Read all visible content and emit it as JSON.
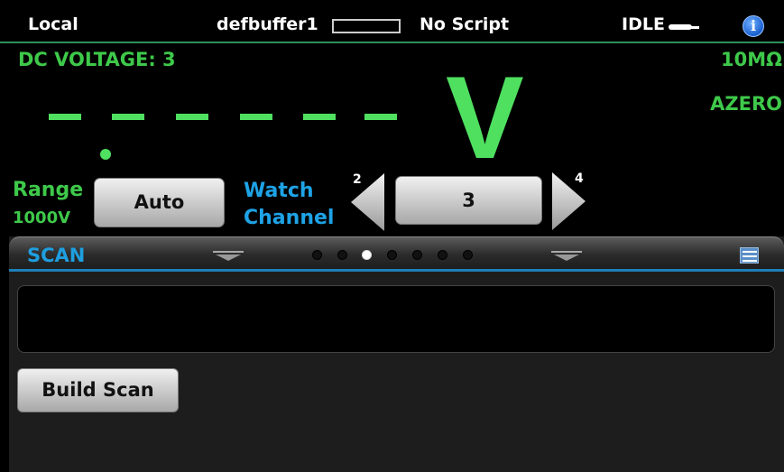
{
  "status_bar": {
    "mode": "Local",
    "buffer_name": "defbuffer1",
    "buffer_fill": 0,
    "script": "No Script",
    "state": "IDLE",
    "info_icon": "info-icon",
    "colors": {
      "separator": "#2f8f5a",
      "info": "#1a5fd0"
    }
  },
  "measurement": {
    "function_label": "DC VOLTAGE: 3",
    "reading": "- - - - - - .",
    "unit": "V",
    "input_impedance": "10MΩ",
    "autozero": "AZERO",
    "color": "#3ec94a"
  },
  "range": {
    "label": "Range",
    "value": "1000V",
    "button_label": "Auto"
  },
  "watch_channel": {
    "label_line1": "Watch",
    "label_line2": "Channel",
    "prev_channel": "2",
    "current_channel": "3",
    "next_channel": "4",
    "color": "#1ea3e6"
  },
  "swipe_panel": {
    "title": "SCAN",
    "page_count": 7,
    "active_page": 3,
    "field_value": "",
    "build_button_label": "Build Scan",
    "icon": "settings-list-icon",
    "colors": {
      "accent": "#1e9fe0"
    }
  }
}
